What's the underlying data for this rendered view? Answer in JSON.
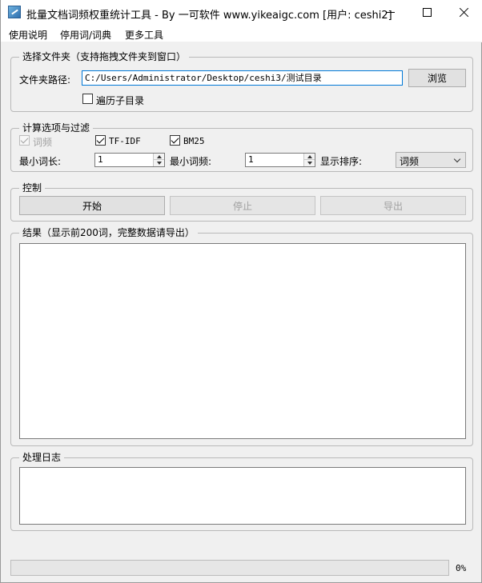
{
  "window": {
    "title": "批量文档词频权重统计工具 - By 一可软件 www.yikeaigc.com [用户: ceshi2]"
  },
  "menu": [
    "使用说明",
    "停用词/词典",
    "更多工具"
  ],
  "folder_group": {
    "title": "选择文件夹（支持拖拽文件夹到窗口）",
    "path_label": "文件夹路径:",
    "path_value": "C:/Users/Administrator/Desktop/ceshi3/测试目录",
    "browse_label": "浏览",
    "recursive_label": "遍历子目录",
    "recursive_checked": false
  },
  "options_group": {
    "title": "计算选项与过滤",
    "metrics": [
      {
        "label": "词频",
        "checked": true,
        "disabled": true
      },
      {
        "label": "TF-IDF",
        "checked": true,
        "disabled": false
      },
      {
        "label": "BM25",
        "checked": true,
        "disabled": false
      }
    ],
    "min_len_label": "最小词长:",
    "min_len_value": "1",
    "min_freq_label": "最小词频:",
    "min_freq_value": "1",
    "sort_label": "显示排序:",
    "sort_value": "词频"
  },
  "control_group": {
    "title": "控制",
    "start_label": "开始",
    "stop_label": "停止",
    "export_label": "导出"
  },
  "results_group": {
    "title": "结果（显示前200词，完整数据请导出）"
  },
  "log_group": {
    "title": "处理日志"
  },
  "progress": {
    "percent": 0,
    "text": "0%"
  },
  "colors": {
    "focus_border": "#0078d7",
    "disabled_text": "#a0a0a0",
    "progress_fill": "#06b025"
  }
}
